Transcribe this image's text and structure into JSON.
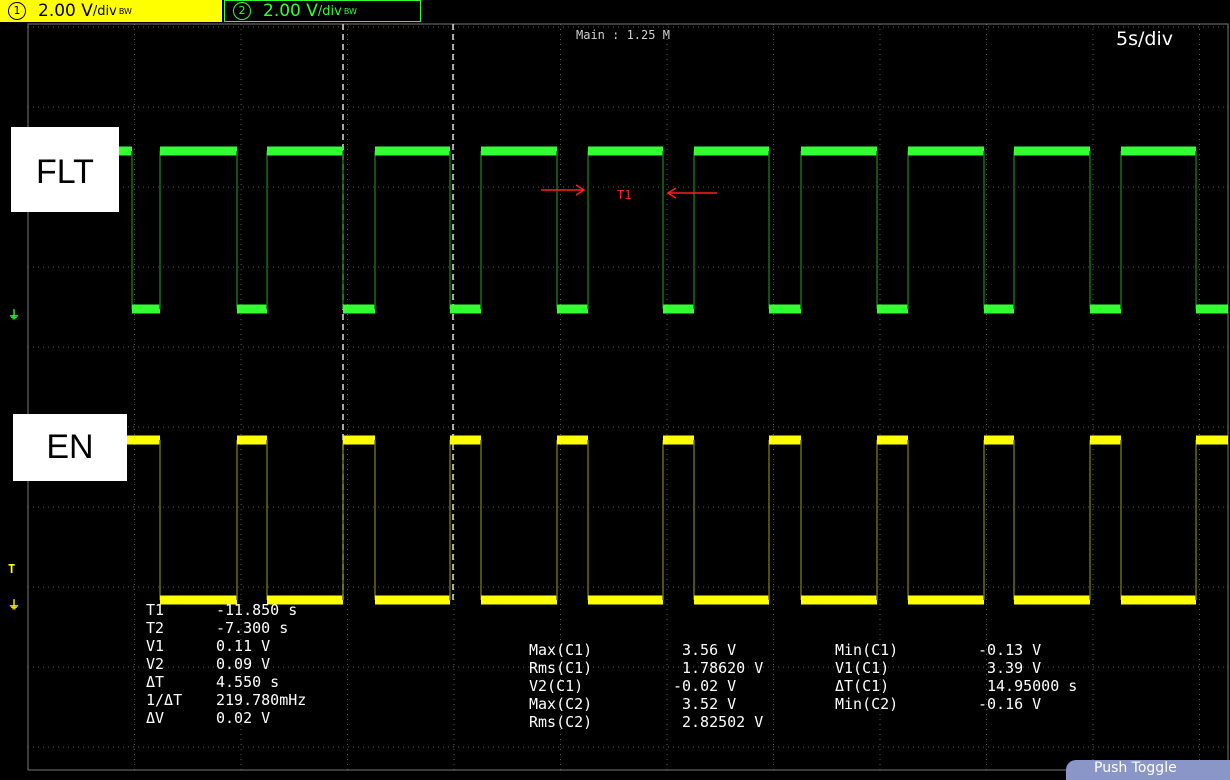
{
  "channels": {
    "ch1": {
      "number": "1",
      "scale": "2.00 V",
      "unit_suffix": "/div",
      "bw_mark": "BW",
      "color": "#ffff00"
    },
    "ch2": {
      "number": "2",
      "scale": "2.00 V",
      "unit_suffix": "/div",
      "bw_mark": "BW",
      "color": "#33ff33"
    }
  },
  "timebase": {
    "main": "Main : 1.25 M",
    "per_div": "5s/div"
  },
  "signal_labels": {
    "flt": "FLT",
    "en": "EN"
  },
  "cursor_label": "T1",
  "cursor_measurements": [
    {
      "label": "T1",
      "value": "-11.850 s"
    },
    {
      "label": "T2",
      "value": "-7.300 s"
    },
    {
      "label": "V1",
      "value": "0.11 V"
    },
    {
      "label": "V2",
      "value": "0.09 V"
    },
    {
      "label": "ΔT",
      "value": "4.550 s"
    },
    {
      "label": "1/ΔT",
      "value": "219.780mHz"
    },
    {
      "label": "ΔV",
      "value": "0.02 V"
    }
  ],
  "auto_measurements_left": [
    {
      "label": "Max(C1)",
      "value": "3.56 V"
    },
    {
      "label": "Rms(C1)",
      "value": "1.78620 V"
    },
    {
      "label": "V2(C1)",
      "value": "-0.02 V"
    },
    {
      "label": "Max(C2)",
      "value": "3.52 V"
    },
    {
      "label": "Rms(C2)",
      "value": "2.82502 V"
    }
  ],
  "auto_measurements_right": [
    {
      "label": "Min(C1)",
      "value": "-0.13 V"
    },
    {
      "label": "V1(C1)",
      "value": "3.39 V"
    },
    {
      "label": "ΔT(C1)",
      "value": "14.95000 s"
    },
    {
      "label": "Min(C2)",
      "value": "-0.16 V"
    }
  ],
  "push_toggle": "Push Toggle",
  "colors": {
    "ch1": "#ffff00",
    "ch2": "#33ff33",
    "grid": "#5a5a5a",
    "cursor": "#ff2020"
  }
}
